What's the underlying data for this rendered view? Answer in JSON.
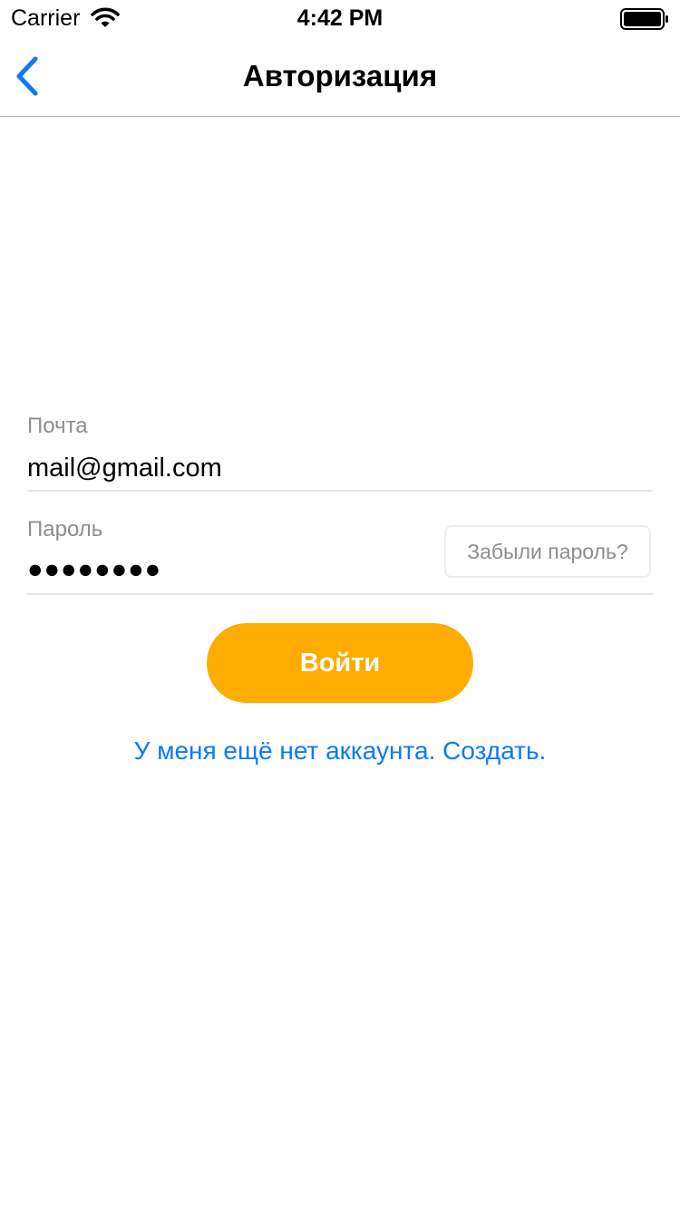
{
  "status_bar": {
    "carrier": "Carrier",
    "time": "4:42 PM",
    "wifi_icon": "wifi-icon",
    "battery_icon": "battery-full-icon"
  },
  "nav": {
    "title": "Авторизация",
    "back_icon": "chevron-left-icon",
    "accent_color": "#0a7aff"
  },
  "form": {
    "email_label": "Почта",
    "email_value": "mail@gmail.com",
    "password_label": "Пароль",
    "password_display": "●●●●●●●●",
    "forgot_label": "Забыли пароль?",
    "login_label": "Войти",
    "login_color": "#ffab00",
    "signup_link": "У меня ещё нет аккаунта. Создать."
  }
}
